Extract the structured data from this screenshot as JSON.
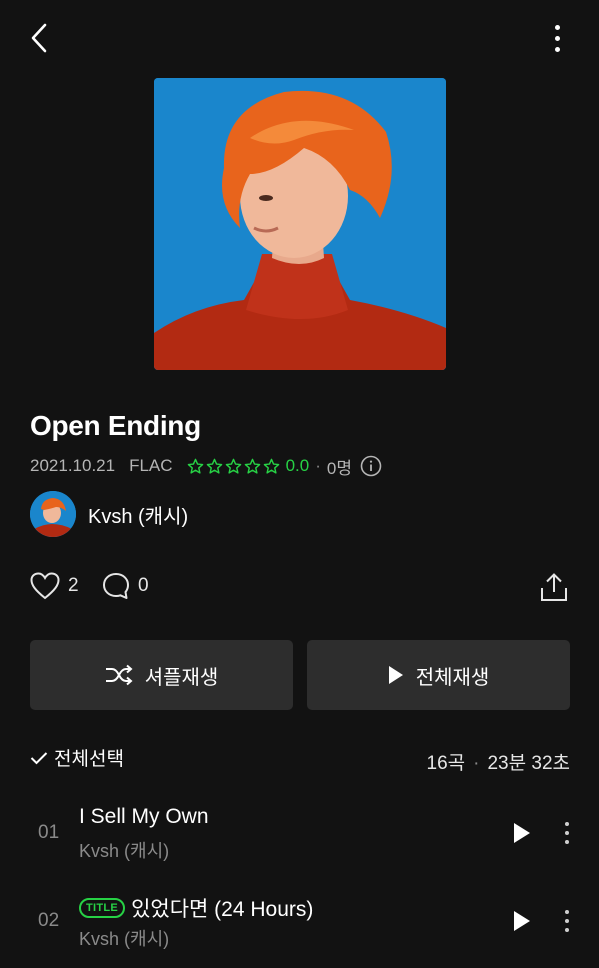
{
  "header": {
    "back_icon": "chevron-left-icon",
    "more_icon": "more-vertical-icon"
  },
  "album": {
    "title": "Open Ending",
    "release_date": "2021.10.21",
    "format": "FLAC",
    "rating": "0.0",
    "rating_stars": 0,
    "rating_count": "0명",
    "cover_bg_color": "#1a86cc"
  },
  "artist": {
    "name": "Kvsh (캐시)"
  },
  "actions": {
    "like_count": "2",
    "comment_count": "0"
  },
  "buttons": {
    "shuffle_label": "셔플재생",
    "play_all_label": "전체재생"
  },
  "tracklist": {
    "select_all_label": "전체선택",
    "track_count": "16곡",
    "total_duration": "23분 32초",
    "tracks": [
      {
        "number": "01",
        "title": "I Sell My Own",
        "artist": "Kvsh (캐시)",
        "badge": ""
      },
      {
        "number": "02",
        "title": "있었다면 (24 Hours)",
        "artist": "Kvsh (캐시)",
        "badge": "TITLE"
      }
    ]
  },
  "colors": {
    "background": "#121212",
    "accent_green": "#27d245",
    "button_bg": "#2d2d2d",
    "muted_text": "#8a8a8a"
  }
}
